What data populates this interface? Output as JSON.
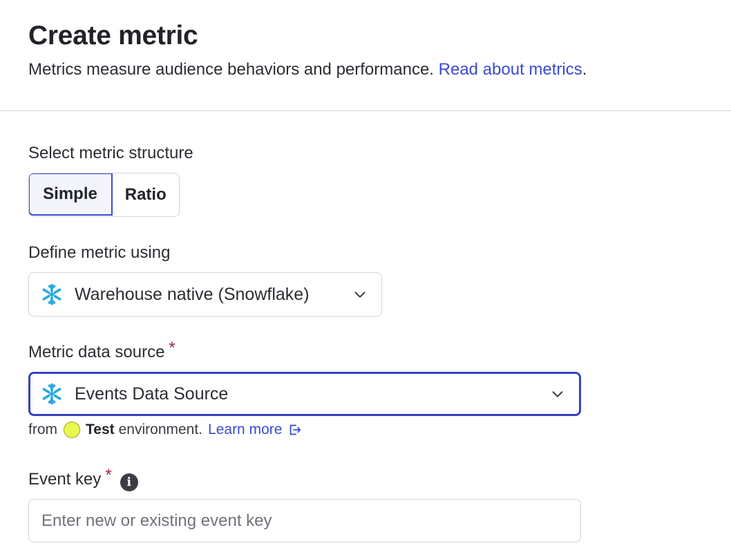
{
  "header": {
    "title": "Create metric",
    "subtitle": "Metrics measure audience behaviors and performance.",
    "link_text": "Read about metrics",
    "link_suffix": "."
  },
  "structure": {
    "label": "Select metric structure",
    "options": [
      "Simple",
      "Ratio"
    ],
    "selected": "Simple"
  },
  "define": {
    "label": "Define metric using",
    "value": "Warehouse native (Snowflake)",
    "icon": "snowflake-icon"
  },
  "data_source": {
    "label": "Metric data source",
    "required_mark": "*",
    "value": "Events Data Source",
    "icon": "snowflake-icon",
    "helper_from": "from",
    "environment": "Test",
    "helper_env_suffix": "environment.",
    "learn_more": "Learn more",
    "environment_color": "#e9f84e"
  },
  "event_key": {
    "label": "Event key",
    "required_mark": "*",
    "info_glyph": "i",
    "placeholder": "Enter new or existing event key",
    "value": ""
  },
  "colors": {
    "accent": "#3a4bd1",
    "required": "#a6224f",
    "snowflake": "#29a9e0"
  }
}
